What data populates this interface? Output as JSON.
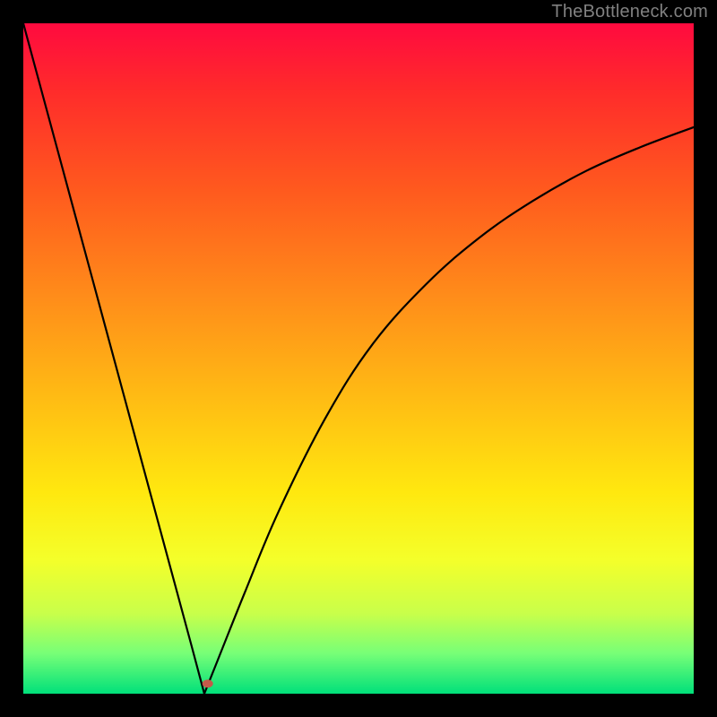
{
  "credit": "TheBottleneck.com",
  "chart_data": {
    "type": "line",
    "title": "",
    "xlabel": "",
    "ylabel": "",
    "x_range": [
      0,
      100
    ],
    "y_range": [
      0,
      100
    ],
    "notch_x": 27,
    "marker": {
      "x": 27.5,
      "y": 1.5,
      "color": "#c45a4a"
    },
    "curve": [
      {
        "x": 0,
        "y": 100
      },
      {
        "x": 5,
        "y": 81.5
      },
      {
        "x": 10,
        "y": 63
      },
      {
        "x": 15,
        "y": 44.5
      },
      {
        "x": 20,
        "y": 26
      },
      {
        "x": 25,
        "y": 7.5
      },
      {
        "x": 27,
        "y": 0
      },
      {
        "x": 29,
        "y": 5
      },
      {
        "x": 33,
        "y": 15
      },
      {
        "x": 38,
        "y": 27
      },
      {
        "x": 45,
        "y": 41
      },
      {
        "x": 52,
        "y": 52
      },
      {
        "x": 60,
        "y": 61
      },
      {
        "x": 68,
        "y": 68
      },
      {
        "x": 76,
        "y": 73.5
      },
      {
        "x": 84,
        "y": 78
      },
      {
        "x": 92,
        "y": 81.5
      },
      {
        "x": 100,
        "y": 84.5
      }
    ],
    "gradient_stops": [
      {
        "offset": 0.0,
        "color": "#ff0a3f"
      },
      {
        "offset": 0.1,
        "color": "#ff2b2b"
      },
      {
        "offset": 0.25,
        "color": "#ff5a1e"
      },
      {
        "offset": 0.4,
        "color": "#ff8a1a"
      },
      {
        "offset": 0.55,
        "color": "#ffb914"
      },
      {
        "offset": 0.7,
        "color": "#ffe80f"
      },
      {
        "offset": 0.8,
        "color": "#f4ff2a"
      },
      {
        "offset": 0.88,
        "color": "#c9ff4a"
      },
      {
        "offset": 0.94,
        "color": "#77ff77"
      },
      {
        "offset": 1.0,
        "color": "#00e07a"
      }
    ]
  }
}
